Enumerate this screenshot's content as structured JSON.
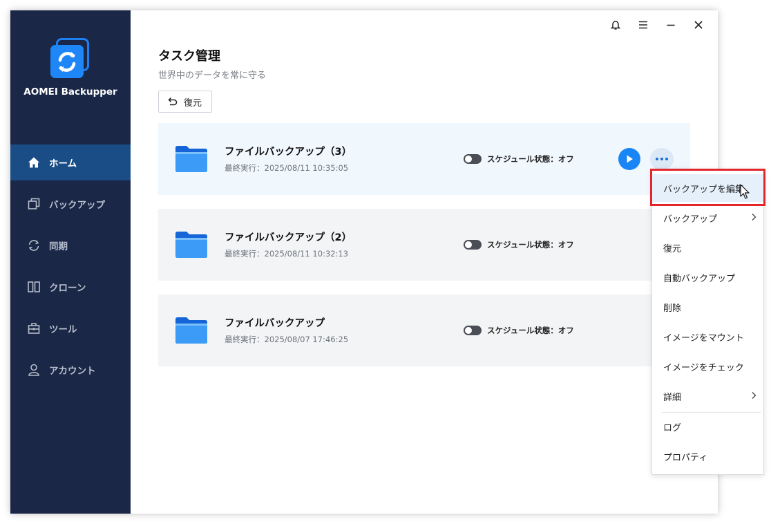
{
  "app": {
    "name": "AOMEI Backupper"
  },
  "nav": {
    "items": [
      {
        "label": "ホーム",
        "icon": "home-icon",
        "active": true
      },
      {
        "label": "バックアップ",
        "icon": "backup-icon",
        "active": false
      },
      {
        "label": "同期",
        "icon": "sync-icon",
        "active": false
      },
      {
        "label": "クローン",
        "icon": "clone-icon",
        "active": false
      },
      {
        "label": "ツール",
        "icon": "tools-icon",
        "active": false
      },
      {
        "label": "アカウント",
        "icon": "account-icon",
        "active": false
      }
    ]
  },
  "titlebar": {
    "icons": [
      "bell-icon",
      "menu-icon",
      "minimize-icon",
      "close-icon"
    ]
  },
  "main": {
    "title": "タスク管理",
    "subtitle": "世界中のデータを常に守る",
    "restore_label": "復元",
    "tasks": [
      {
        "name": "ファイルバックアップ（3）",
        "last_run": "最終実行：2025/08/11 10:35:05",
        "schedule": "スケジュール状態：オフ",
        "selected": true
      },
      {
        "name": "ファイルバックアップ（2）",
        "last_run": "最終実行：2025/08/11 10:32:13",
        "schedule": "スケジュール状態：オフ",
        "selected": false
      },
      {
        "name": "ファイルバックアップ",
        "last_run": "最終実行：2025/08/07 17:46:25",
        "schedule": "スケジュール状態：オフ",
        "selected": false
      }
    ]
  },
  "context_menu": {
    "items": [
      {
        "label": "バックアップを編集",
        "submenu": false,
        "highlighted": true
      },
      {
        "label": "バックアップ",
        "submenu": true
      },
      {
        "label": "復元",
        "submenu": false
      },
      {
        "label": "自動バックアップ",
        "submenu": false
      },
      {
        "label": "削除",
        "submenu": false
      },
      {
        "label": "イメージをマウント",
        "submenu": false
      },
      {
        "label": "イメージをチェック",
        "submenu": false
      },
      {
        "label": "詳細",
        "submenu": true
      },
      {
        "label": "ログ",
        "submenu": false
      },
      {
        "label": "プロパティ",
        "submenu": false
      }
    ]
  },
  "colors": {
    "sidebar_bg": "#1a2747",
    "nav_active_bg": "#1a4d86",
    "accent_blue": "#1a86f5",
    "highlight_red": "#e3262b"
  }
}
